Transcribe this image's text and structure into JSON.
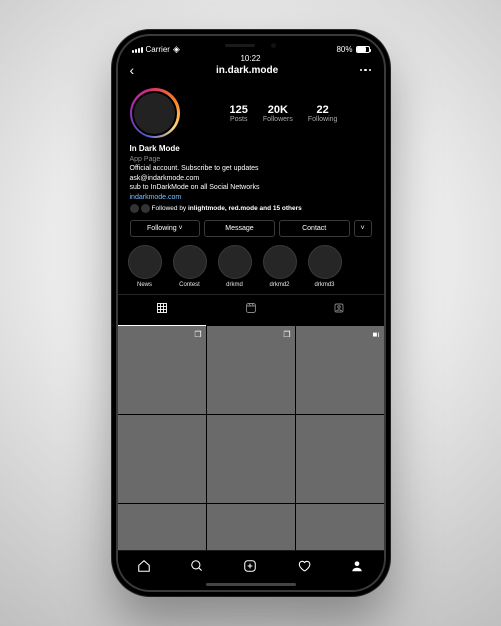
{
  "status": {
    "carrier": "Carrier",
    "time": "10:22",
    "battery": "80%"
  },
  "header": {
    "username": "in.dark.mode"
  },
  "profile": {
    "stats": [
      {
        "n": "125",
        "l": "Posts"
      },
      {
        "n": "20K",
        "l": "Followers"
      },
      {
        "n": "22",
        "l": "Following"
      }
    ],
    "name": "In Dark Mode",
    "category": "App Page",
    "line1": "Official account. Subscribe to get updates",
    "line2": "ask@indarkmode.com",
    "line3": "sub to InDarkMode on all Social Networks",
    "link": "indarkmode.com",
    "followed_pre": "Followed by ",
    "followed_bold": "inlightmode, red.mode and 15 others"
  },
  "actions": {
    "following": "Following ˅",
    "message": "Message",
    "contact": "Contact",
    "more": "˅"
  },
  "highlights": [
    {
      "t": "News"
    },
    {
      "t": "Contest"
    },
    {
      "t": "drkmd"
    },
    {
      "t": "drkmd2"
    },
    {
      "t": "drkmd3"
    }
  ]
}
